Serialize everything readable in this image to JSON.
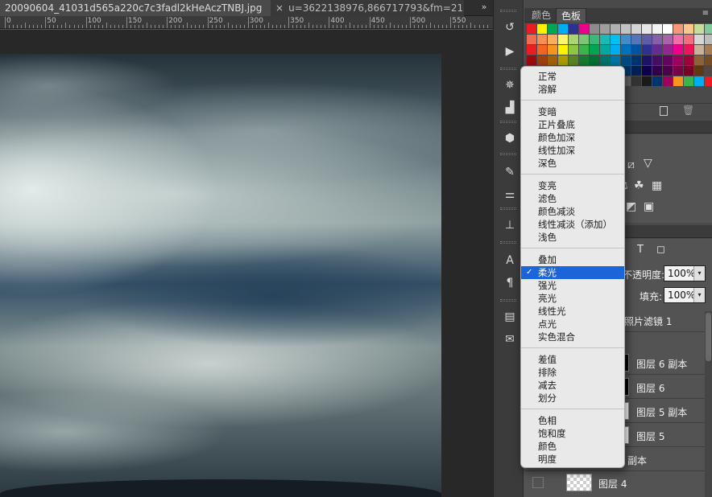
{
  "document_tabs": [
    {
      "label": "20090604_41031d565a220c7c3fadl2kHeAczTNBJ.jpg",
      "close": "×"
    },
    {
      "label": "u=3622138976,866717793&fm=21&"
    }
  ],
  "tab_overflow": "»",
  "ruler": {
    "labels": [
      "0",
      "50",
      "100",
      "150",
      "200",
      "250",
      "300",
      "350",
      "400",
      "450",
      "500",
      "550"
    ]
  },
  "tools": {
    "icons": [
      "history-brush",
      "play",
      "wheel",
      "levels",
      "cube",
      "brush-settings",
      "sliders",
      "stamp",
      "character",
      "paragraph",
      "notes",
      "comments"
    ]
  },
  "swatches_panel": {
    "tabs": [
      "颜色",
      "色板"
    ],
    "active_tab": "色板",
    "menu_icon": "≡",
    "colors": [
      "#ed1c24",
      "#fff200",
      "#00a651",
      "#00aeef",
      "#2e3192",
      "#ec008c",
      "#8c8c8c",
      "#9e9e9e",
      "#b0b0b0",
      "#c2c2c2",
      "#d4d4d4",
      "#e6e6e6",
      "#f2f2f2",
      "#ffffff",
      "#f7977a",
      "#fdc68a",
      "#c4df9b",
      "#82ca9c",
      "#f26c4f",
      "#f68e55",
      "#fbaf5d",
      "#fff568",
      "#acd372",
      "#7cc576",
      "#3bb878",
      "#1abbb4",
      "#00bff3",
      "#438ccb",
      "#5574b9",
      "#605ca8",
      "#8560a8",
      "#a864a8",
      "#f06ea9",
      "#f26d7d",
      "#d6d6d6",
      "#bdbdbd",
      "#ed1c24",
      "#f26522",
      "#f7941d",
      "#fff200",
      "#8dc63f",
      "#39b54a",
      "#00a651",
      "#00a99d",
      "#00aeef",
      "#0072bc",
      "#0054a6",
      "#2e3192",
      "#662d91",
      "#92278f",
      "#ec008c",
      "#ed145b",
      "#c7b299",
      "#a67c52",
      "#9e0b0f",
      "#a0410d",
      "#a36209",
      "#aba000",
      "#598527",
      "#197b30",
      "#007236",
      "#00746b",
      "#0076a3",
      "#004a80",
      "#003471",
      "#1b1464",
      "#440e62",
      "#630460",
      "#9e005d",
      "#9e0039",
      "#8c6239",
      "#754c24",
      "#790000",
      "#7b2e00",
      "#7d4900",
      "#827b00",
      "#406618",
      "#005e20",
      "#005826",
      "#005952",
      "#005b7f",
      "#003663",
      "#002157",
      "#0d004c",
      "#32004b",
      "#4b0049",
      "#7b0046",
      "#7a0026",
      "#603913",
      "#534741",
      "#534741",
      "#736357",
      "#998675",
      "#c7b299",
      "#000000",
      "#ffffff",
      "#e6e6e6",
      "#ccc",
      "#999",
      "#666",
      "#333",
      "#1a1a1a",
      "#003471",
      "#9e005d",
      "#f7941d",
      "#39b54a",
      "#00aeef",
      "#ed1c24"
    ]
  },
  "adjustments_panel": {
    "icons": [
      "curves-icon",
      "exposure-icon",
      "color-balance-icon",
      "channel-mixer-icon",
      "lookup-icon",
      "invert-icon",
      "gradient-map-icon",
      "selective-color-icon"
    ]
  },
  "layers_panel": {
    "toolbar_icons": [
      "T",
      "◻"
    ],
    "opacity_label": "不透明度:",
    "opacity_value": "100%",
    "fill_label": "填充:",
    "fill_value": "100%",
    "dropdown_arrow": "▾",
    "rows": [
      {
        "name": "照片滤镜 1"
      },
      {
        "name": "图层 6 副本"
      },
      {
        "name": "图层 6"
      },
      {
        "name": "图层 5 副本"
      },
      {
        "name": "图层 5"
      },
      {
        "name": "副本"
      }
    ],
    "last_layer": {
      "name": "图层 4"
    }
  },
  "blend_menu": {
    "groups": [
      [
        "正常",
        "溶解"
      ],
      [
        "变暗",
        "正片叠底",
        "颜色加深",
        "线性加深",
        "深色"
      ],
      [
        "变亮",
        "滤色",
        "颜色减淡",
        "线性减淡（添加）",
        "浅色"
      ],
      [
        "叠加",
        "柔光",
        "强光",
        "亮光",
        "线性光",
        "点光",
        "实色混合"
      ],
      [
        "差值",
        "排除",
        "减去",
        "划分"
      ],
      [
        "色相",
        "饱和度",
        "颜色",
        "明度"
      ]
    ],
    "selected": "柔光",
    "check_mark": "✓"
  }
}
